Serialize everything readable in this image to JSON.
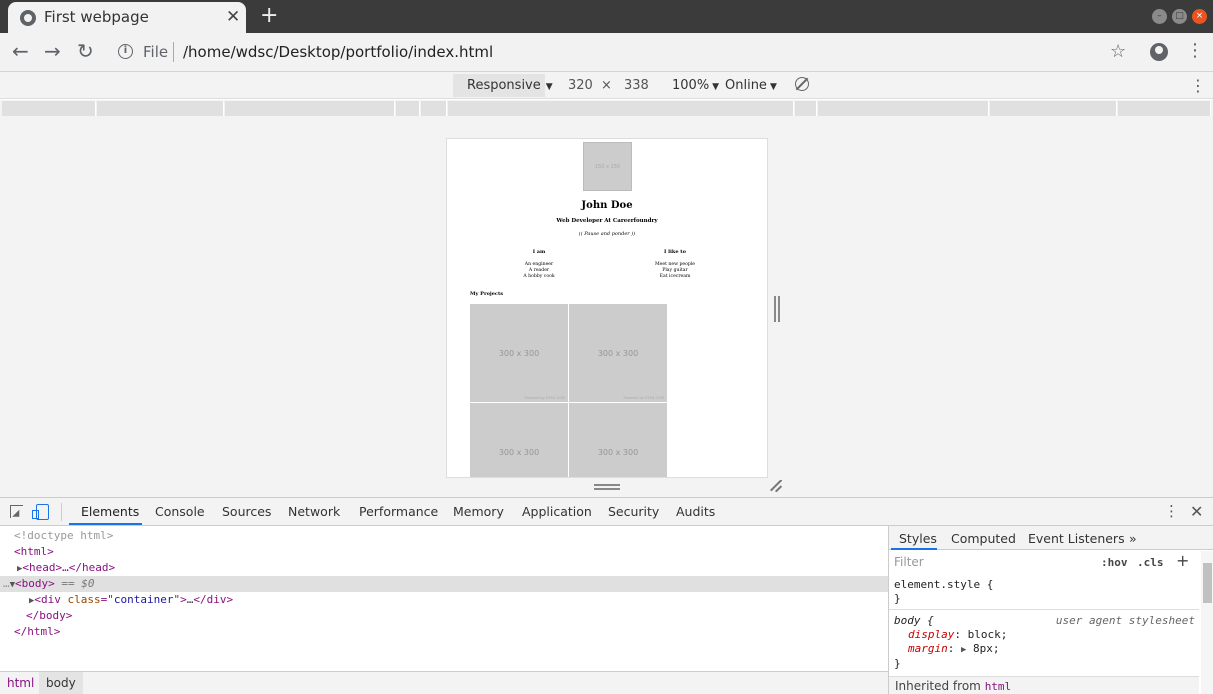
{
  "browser": {
    "tab_title": "First webpage",
    "tab_close": "✕",
    "new_tab": "+",
    "url_scheme": "File",
    "url_path": "/home/wdsc/Desktop/portfolio/index.html"
  },
  "device_toolbar": {
    "mode": "Responsive",
    "width": "320",
    "times": "×",
    "height": "338",
    "zoom": "100%",
    "network": "Online"
  },
  "page": {
    "avatar_placeholder": "150 x 150",
    "name": "John Doe",
    "role": "Web Developer At Careerfoundry",
    "quote": "(( Pause and ponder ))",
    "i_am_heading": "I am",
    "i_am_items": [
      "An engineer",
      "A reader",
      "A hobby cook"
    ],
    "i_like_heading": "I like to",
    "i_like_items": [
      "Meet new people",
      "Play guitar",
      "Eat icecream"
    ],
    "projects_heading": "My Projects",
    "thumbnails": [
      {
        "label": "300 x 300",
        "credit": "Powered by HTML.COM"
      },
      {
        "label": "300 x 300",
        "credit": "Powered by HTML.COM"
      },
      {
        "label": "300 x 300",
        "credit": ""
      },
      {
        "label": "300 x 300",
        "credit": ""
      }
    ]
  },
  "devtools": {
    "tabs": [
      "Elements",
      "Console",
      "Sources",
      "Network",
      "Performance",
      "Memory",
      "Application",
      "Security",
      "Audits"
    ],
    "active_tab": "Elements",
    "dom": {
      "doctype": "<!doctype html>",
      "html_open": "<html>",
      "head": "<head>…</head>",
      "body_open": "<body>",
      "body_marker": " == $0",
      "div_tag": "div",
      "div_attr": "class",
      "div_val": "container",
      "body_close": "</body>",
      "html_close": "</html>"
    },
    "breadcrumbs": [
      "html",
      "body"
    ],
    "styles": {
      "tabs": [
        "Styles",
        "Computed",
        "Event Listeners"
      ],
      "filter_placeholder": "Filter",
      "hov": ":hov",
      "cls": ".cls",
      "element_style": "element.style {",
      "close_brace": "}",
      "body_selector": "body {",
      "ua_label": "user agent stylesheet",
      "prop1_name": "display",
      "prop1_value": "block;",
      "prop2_name": "margin",
      "prop2_value": "8px;",
      "inherited_label": "Inherited from",
      "inherited_tag": "html"
    }
  }
}
